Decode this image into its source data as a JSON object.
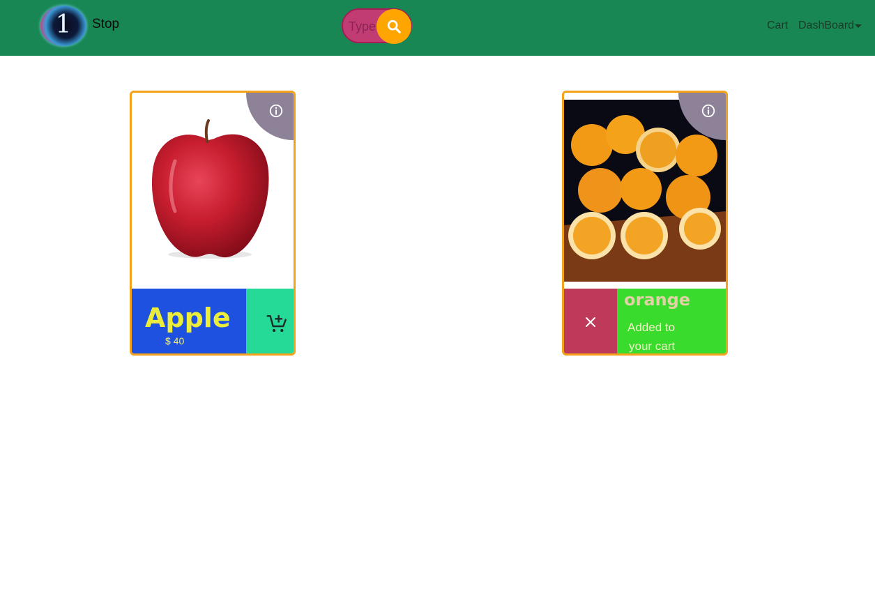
{
  "navbar": {
    "logo_digit": "1",
    "brand": "Stop",
    "search": {
      "placeholder": "Type"
    },
    "links": {
      "cart": "Cart",
      "dashboard": "DashBoard"
    }
  },
  "colors": {
    "navbar_bg": "#198754",
    "search_bg": "#c23c74",
    "search_button": "#ffa500",
    "card_border": "#f4a11c",
    "info_corner": "#8e8299",
    "apple_label_bg": "#1f51e0",
    "apple_cart_bg": "#25d996",
    "orange_close_bg": "#bf3a5a",
    "orange_info_bg": "#39db2c"
  },
  "products": [
    {
      "name": "Apple",
      "price": "$ 40",
      "image": "red-apple-image",
      "action_icon": "cart-add-icon"
    },
    {
      "name": "orange",
      "status_line1": "Added to",
      "status_line2": "your cart",
      "image": "oranges-image",
      "action_icon": "close-icon"
    }
  ]
}
